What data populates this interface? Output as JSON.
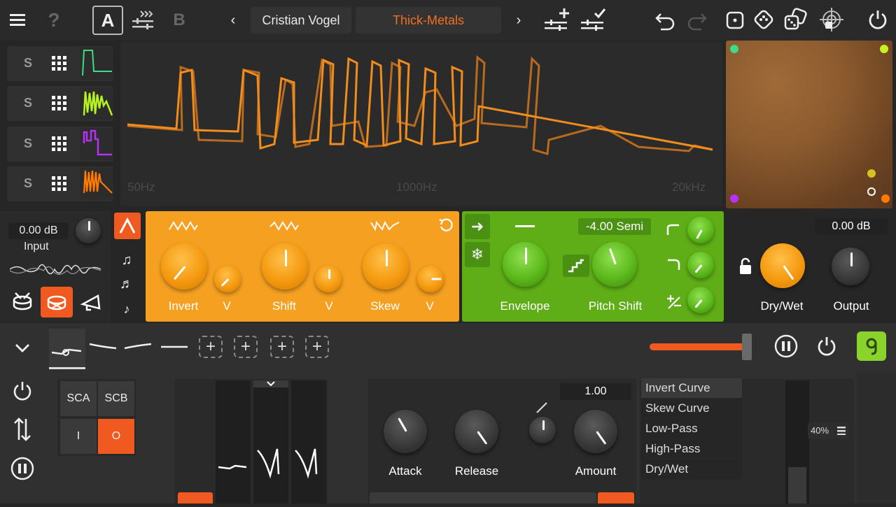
{
  "top_bar": {
    "preset_a": "A",
    "preset_b": "B",
    "author": "Cristian Vogel",
    "preset_name": "Thick-Metals",
    "icons": [
      "menu-icon",
      "help-icon",
      "morph-icon",
      "prev-icon",
      "next-icon",
      "add-slider-icon",
      "confirm-slider-icon",
      "undo-icon",
      "redo-icon",
      "dice-one-icon",
      "dice-two-icon",
      "dice-three-icon",
      "target-icon",
      "power-icon"
    ]
  },
  "layers": [
    {
      "solo": "S",
      "color": "#3ddc84"
    },
    {
      "solo": "S",
      "color": "#b6f21d"
    },
    {
      "solo": "S",
      "color": "#b531f5"
    },
    {
      "solo": "S",
      "color": "#ff7a00"
    }
  ],
  "spectrum": {
    "freq_labels": [
      "50Hz",
      "1000Hz",
      "20kHz"
    ]
  },
  "input": {
    "db": "0.00 dB",
    "label": "Input"
  },
  "shaper": {
    "invert_label": "Invert",
    "shift_label": "Shift",
    "skew_label": "Skew",
    "v_label": "V"
  },
  "pitch": {
    "semi_value": "-4.00 Semi",
    "envelope_label": "Envelope",
    "pitch_label": "Pitch Shift"
  },
  "output": {
    "db": "0.00 dB",
    "drywet_label": "Dry/Wet",
    "output_label": "Output"
  },
  "modulation": {
    "sc_a": "SCA",
    "sc_b": "SCB",
    "in_label": "I",
    "out_label": "O",
    "amount_value": "1.00",
    "attack_label": "Attack",
    "release_label": "Release",
    "amount_label": "Amount",
    "percent": "40%",
    "slider_level": 0.95,
    "targets": [
      "Invert Curve",
      "Skew Curve",
      "Low-Pass",
      "High-Pass",
      "Dry/Wet"
    ]
  }
}
